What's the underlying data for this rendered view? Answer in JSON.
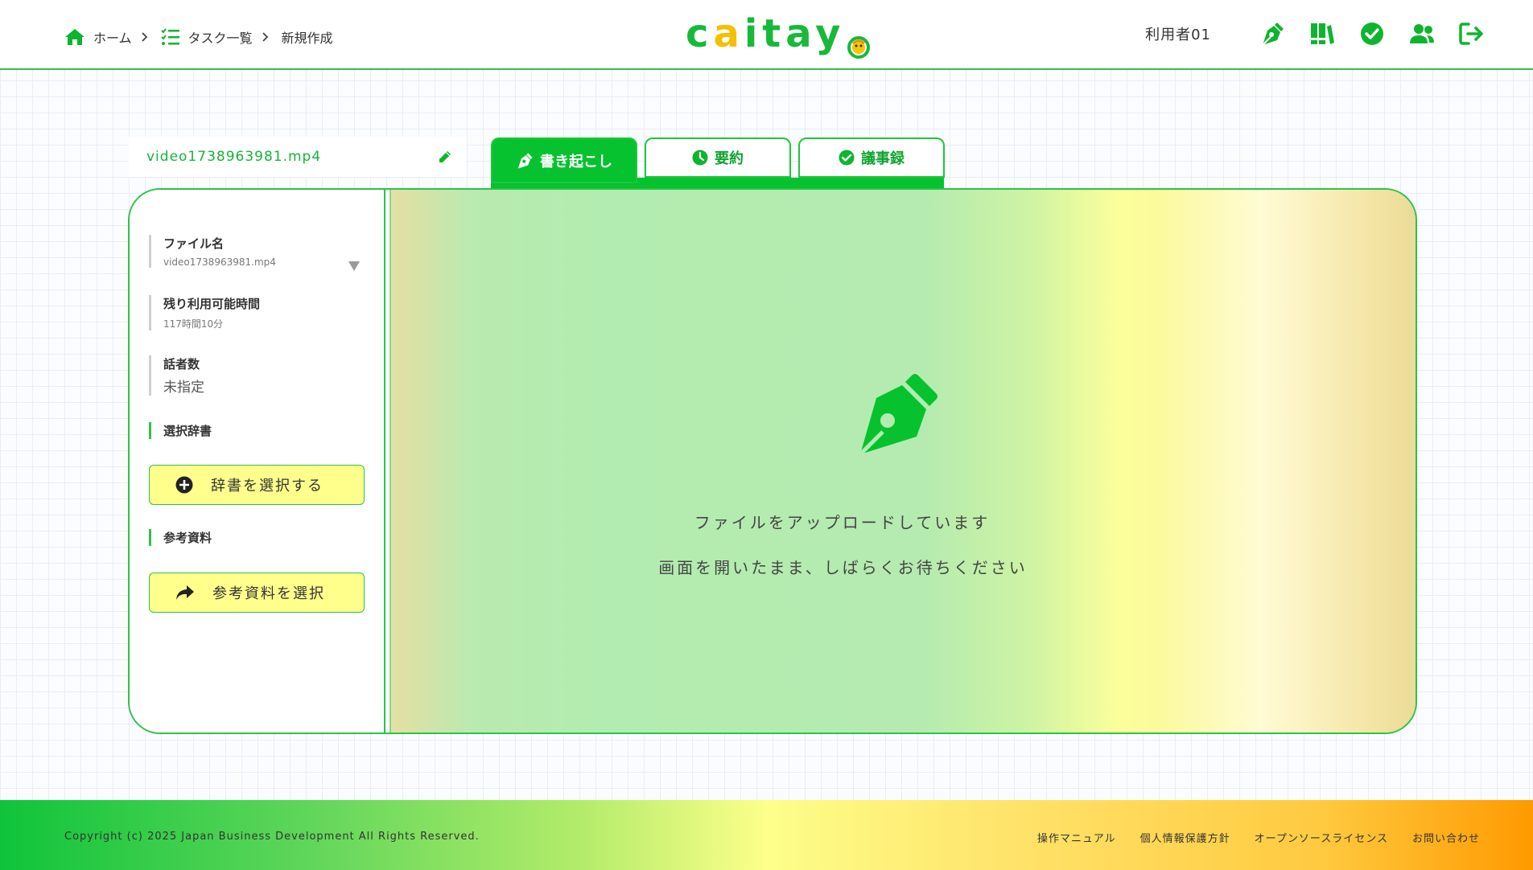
{
  "colors": {
    "brand_green": "#06c22f",
    "logo_yellow": "#f4c000",
    "button_yellow": "#ffff8c"
  },
  "header": {
    "breadcrumb": [
      {
        "label": "ホーム",
        "icon": "home-icon"
      },
      {
        "label": "タスク一覧",
        "icon": "task-list-icon"
      },
      {
        "label": "新規作成"
      }
    ],
    "logo": {
      "c": "c",
      "a": "a",
      "rest": "itay"
    },
    "username": "利用者01",
    "icons": [
      "fountain-pen-icon",
      "books-icon",
      "check-circle-icon",
      "users-icon",
      "logout-icon"
    ]
  },
  "file": {
    "name": "video1738963981.mp4"
  },
  "tabs": [
    {
      "label": "書き起こし",
      "icon": "fountain-pen-icon",
      "active": true
    },
    {
      "label": "要約",
      "icon": "clock-icon",
      "active": false
    },
    {
      "label": "議事録",
      "icon": "check-circle-icon",
      "active": false
    }
  ],
  "sidebar": {
    "file_label": "ファイル名",
    "file_value": "video1738963981.mp4",
    "remaining_label": "残り利用可能時間",
    "remaining_value": "117時間10分",
    "speakers_label": "話者数",
    "speakers_value": "未指定",
    "dictionary_label": "選択辞書",
    "dictionary_button": "辞書を選択する",
    "reference_label": "参考資料",
    "reference_button": "参考資料を選択"
  },
  "content": {
    "message_line1": "ファイルをアップロードしています",
    "message_line2": "画面を開いたまま、しばらくお待ちください"
  },
  "footer": {
    "copyright": "Copyright (c) 2025 Japan Business Development All Rights Reserved.",
    "links": [
      "操作マニュアル",
      "個人情報保護方針",
      "オープンソースライセンス",
      "お問い合わせ"
    ]
  }
}
